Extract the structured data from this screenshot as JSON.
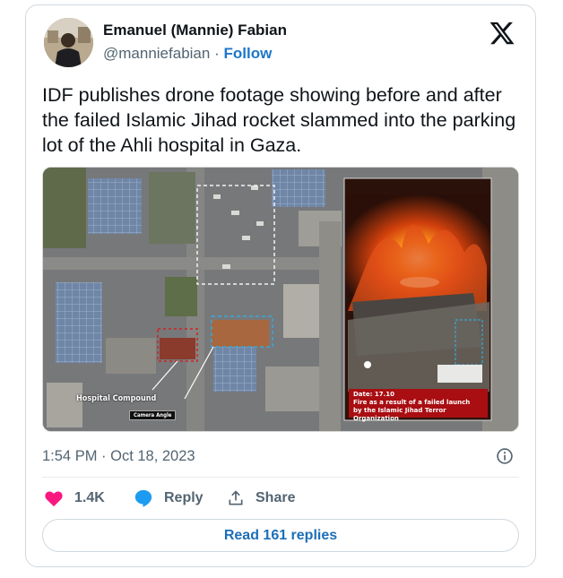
{
  "author": {
    "display_name": "Emanuel (Mannie) Fabian",
    "handle": "@manniefabian",
    "separator": "·",
    "follow_label": "Follow"
  },
  "tweet": {
    "text": "IDF publishes drone footage showing before and after the failed Islamic Jihad rocket slammed into the parking lot of the Ahli hospital in Gaza.",
    "timestamp": "1:54 PM · Oct 18, 2023"
  },
  "media": {
    "hospital_label": "Hospital Compound",
    "camera_label": "Camera Angle",
    "caption_date": "Date: 17.10",
    "caption_line1": "Fire as a result of a failed launch",
    "caption_line2": "by the Islamic Jihad Terror Organization"
  },
  "actions": {
    "like_count": "1.4K",
    "reply_label": "Reply",
    "share_label": "Share"
  },
  "read_replies_label": "Read 161 replies",
  "colors": {
    "like": "#f91880",
    "reply": "#1d9bf0",
    "link": "#1d77c9",
    "caption_bg": "#a90e12"
  },
  "icons": [
    "x-logo-icon",
    "heart-icon",
    "reply-bubble-icon",
    "share-icon",
    "info-icon"
  ]
}
